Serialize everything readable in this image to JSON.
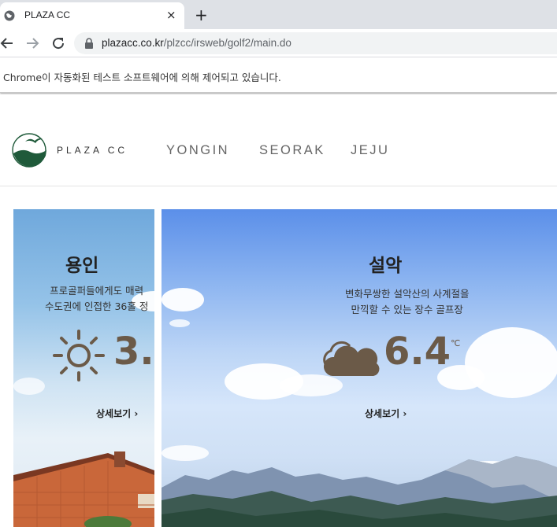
{
  "browser": {
    "tab_title": "PLAZA CC",
    "tab_close": "×",
    "new_tab": "+",
    "url_domain": "plazacc.co.kr",
    "url_path": "/plzcc/irsweb/golf2/main.do",
    "infobar_message": "Chrome이 자동화된 테스트 소프트웨어에 의해 제어되고 있습니다."
  },
  "site": {
    "logo_text": "PLAZA CC",
    "menu": [
      "YONGIN",
      "SEORAK",
      "JEJU"
    ]
  },
  "panels": [
    {
      "title": "용인",
      "desc_line1": "프로골퍼들에게도 매력",
      "desc_line2": "수도권에 인접한 36홀 정",
      "weather_icon": "sun-icon",
      "temperature": "3.",
      "more_label": "상세보기 ›"
    },
    {
      "title": "설악",
      "desc_line1": "변화무쌍한 설악산의 사계절을",
      "desc_line2": "만끽할 수 있는 장수 골프장",
      "weather_icon": "cloud-icon",
      "temperature": "6.4",
      "unit": "℃",
      "more_label": "상세보기 ›"
    }
  ],
  "colors": {
    "temp_brown": "#6b5a48",
    "logo_green": "#1f5a3a"
  }
}
